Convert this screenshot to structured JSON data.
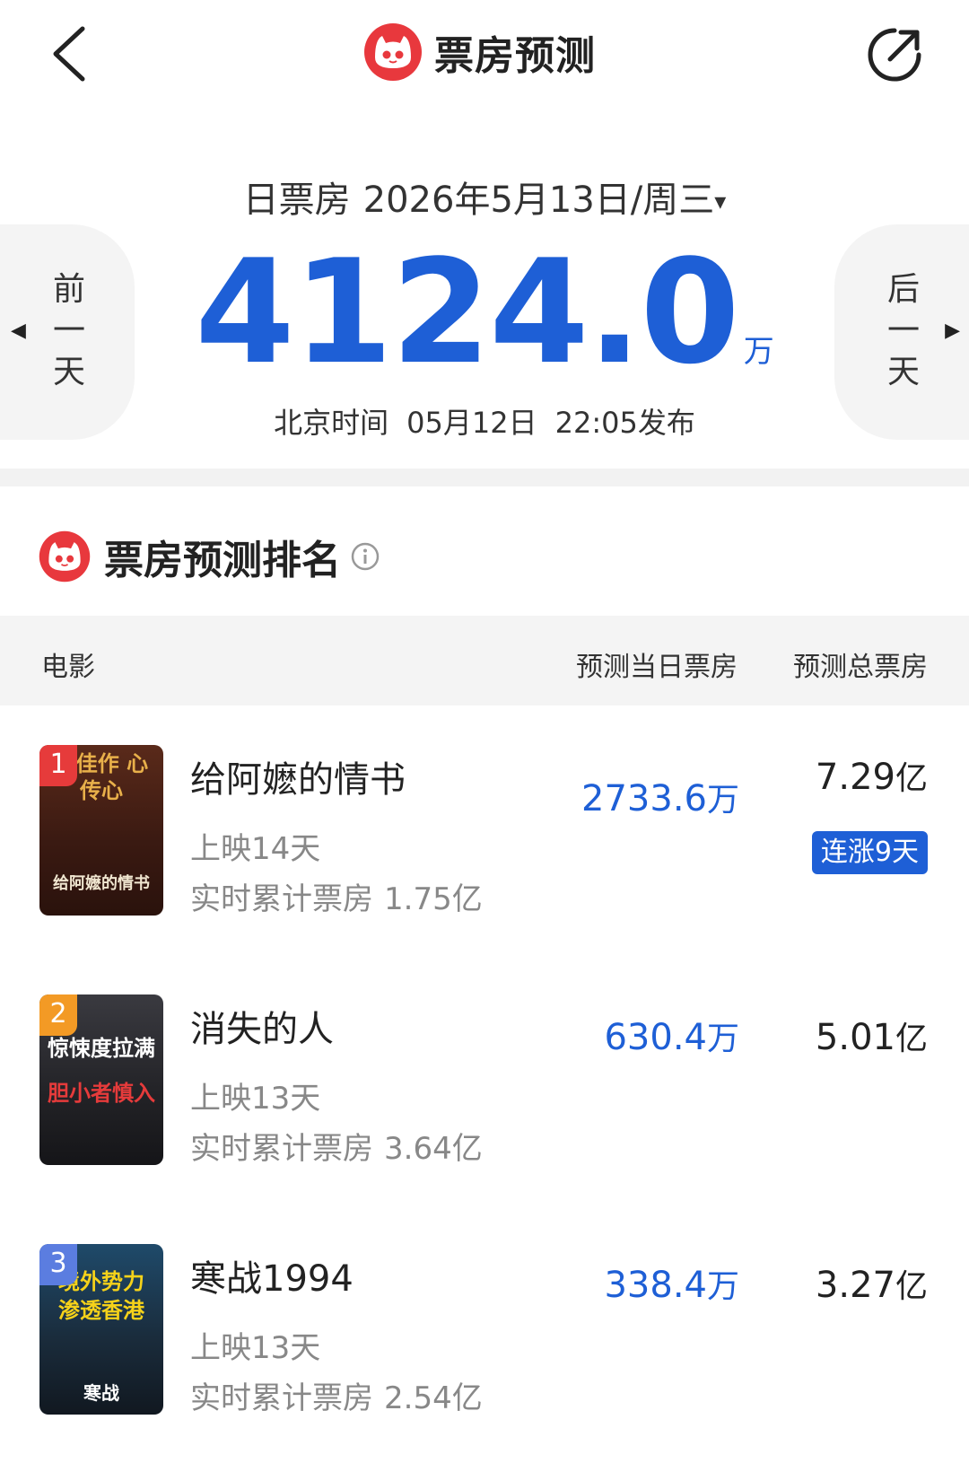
{
  "header": {
    "title": "票房预测"
  },
  "date": {
    "label": "日票房",
    "value": "2026年5月13日/周三",
    "caret": "▾"
  },
  "nav": {
    "prev": [
      "前",
      "一",
      "天"
    ],
    "next": [
      "后",
      "一",
      "天"
    ]
  },
  "total": {
    "value": "4124.0",
    "unit": "万"
  },
  "publish": {
    "prefix": "北京时间",
    "date": "05月12日",
    "time": "22:05发布"
  },
  "ranking": {
    "title": "票房预测排名",
    "columns": {
      "movie": "电影",
      "day": "预测当日票房",
      "total": "预测总票房"
    },
    "movies": [
      {
        "rank": "1",
        "title": "给阿嬷的情书",
        "days": "上映14天",
        "cum_label": "实时累计票房",
        "cum_value": "1.75亿",
        "day_value": "2733.6",
        "day_unit": "万",
        "total_value": "7.29",
        "total_unit": "亿",
        "streak": "连涨9天",
        "poster_top": "惮佳作 心传心",
        "poster_bottom": "给阿嬷的情书",
        "badge_color": "#e63b3b",
        "poster_color": "#4a2418"
      },
      {
        "rank": "2",
        "title": "消失的人",
        "days": "上映13天",
        "cum_label": "实时累计票房",
        "cum_value": "3.64亿",
        "day_value": "630.4",
        "day_unit": "万",
        "total_value": "5.01",
        "total_unit": "亿",
        "streak": "",
        "poster_top": "惊悚度拉满",
        "poster_bottom": "胆小者慎入",
        "badge_color": "#f39a25",
        "poster_color": "#2a2a2e"
      },
      {
        "rank": "3",
        "title": "寒战1994",
        "days": "上映13天",
        "cum_label": "实时累计票房",
        "cum_value": "2.54亿",
        "day_value": "338.4",
        "day_unit": "万",
        "total_value": "3.27",
        "total_unit": "亿",
        "streak": "",
        "poster_top": "境外势力 渗透香港",
        "poster_bottom": "寒战",
        "badge_color": "#5b7de0",
        "poster_color": "#1c2a3a"
      }
    ]
  }
}
